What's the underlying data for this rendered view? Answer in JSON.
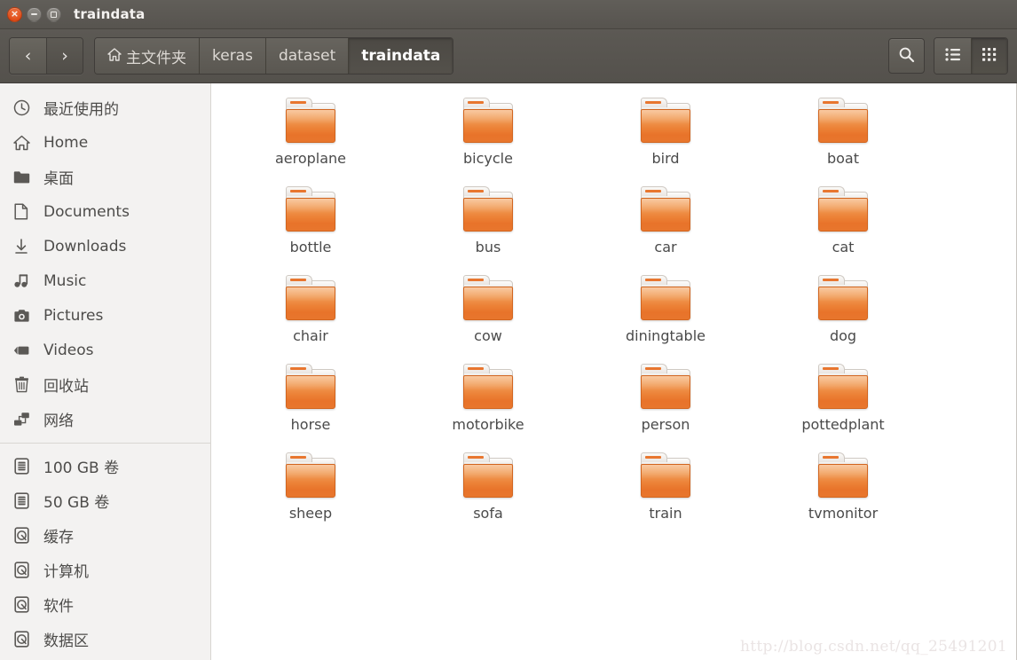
{
  "window": {
    "title": "traindata",
    "controls": [
      {
        "name": "close",
        "icon": "close-icon"
      },
      {
        "name": "minimize",
        "icon": "minimize-icon"
      },
      {
        "name": "maximize",
        "icon": "maximize-icon"
      }
    ]
  },
  "toolbar": {
    "back_label": "‹",
    "forward_label": "›",
    "back_icon": "chevron-left-icon",
    "forward_icon": "chevron-right-icon",
    "search_icon": "search-icon",
    "list_view_icon": "list-view-icon",
    "grid_view_icon": "grid-view-icon",
    "active_view": "grid",
    "breadcrumbs": [
      {
        "label": "主文件夹",
        "icon": "home-icon",
        "active": false
      },
      {
        "label": "keras",
        "icon": "",
        "active": false
      },
      {
        "label": "dataset",
        "icon": "",
        "active": false
      },
      {
        "label": "traindata",
        "icon": "",
        "active": true
      }
    ]
  },
  "sidebar": {
    "places": [
      {
        "label": "最近使用的",
        "icon": "clock-icon"
      },
      {
        "label": "Home",
        "icon": "home-icon"
      },
      {
        "label": "桌面",
        "icon": "folder-icon"
      },
      {
        "label": "Documents",
        "icon": "document-icon"
      },
      {
        "label": "Downloads",
        "icon": "download-icon"
      },
      {
        "label": "Music",
        "icon": "music-note-icon"
      },
      {
        "label": "Pictures",
        "icon": "camera-icon"
      },
      {
        "label": "Videos",
        "icon": "video-icon"
      },
      {
        "label": "回收站",
        "icon": "trash-icon"
      },
      {
        "label": "网络",
        "icon": "network-icon"
      }
    ],
    "volumes": [
      {
        "label": "100 GB 卷",
        "icon": "drive-icon"
      },
      {
        "label": "50 GB 卷",
        "icon": "drive-icon"
      },
      {
        "label": "缓存",
        "icon": "disk-icon"
      },
      {
        "label": "计算机",
        "icon": "disk-icon"
      },
      {
        "label": "软件",
        "icon": "disk-icon"
      },
      {
        "label": "数据区",
        "icon": "disk-icon"
      }
    ]
  },
  "content": {
    "folders": [
      {
        "label": "aeroplane"
      },
      {
        "label": "bicycle"
      },
      {
        "label": "bird"
      },
      {
        "label": "boat"
      },
      {
        "label": "bottle"
      },
      {
        "label": "bus"
      },
      {
        "label": "car"
      },
      {
        "label": "cat"
      },
      {
        "label": "chair"
      },
      {
        "label": "cow"
      },
      {
        "label": "diningtable"
      },
      {
        "label": "dog"
      },
      {
        "label": "horse"
      },
      {
        "label": "motorbike"
      },
      {
        "label": "person"
      },
      {
        "label": "pottedplant"
      },
      {
        "label": "sheep"
      },
      {
        "label": "sofa"
      },
      {
        "label": "train"
      },
      {
        "label": "tvmonitor"
      }
    ],
    "watermark": "http://blog.csdn.net/qq_25491201"
  },
  "colors": {
    "titlebar": "#5c5954",
    "sidebar_bg": "#f3f2f1",
    "content_bg": "#ffffff",
    "folder_orange": "#e8762d",
    "close_button": "#dd4814",
    "label_text": "#4a4a4a"
  }
}
